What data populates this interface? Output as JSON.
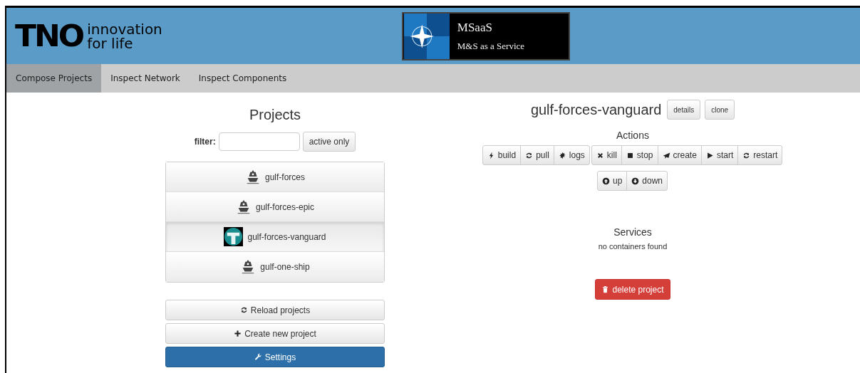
{
  "header": {
    "logo": {
      "mark": "TNO",
      "tagline_1": "innovation",
      "tagline_2": "for life"
    },
    "banner": {
      "title": "MSaaS",
      "subtitle": "M&S as a Service"
    }
  },
  "tabs": [
    {
      "label": "Compose Projects",
      "selected": true
    },
    {
      "label": "Inspect Network",
      "selected": false
    },
    {
      "label": "Inspect Components",
      "selected": false
    }
  ],
  "projects": {
    "title": "Projects",
    "filter_label": "filter:",
    "active_only": "active only",
    "items": [
      {
        "name": "gulf-forces",
        "kind": "ship",
        "selected": false
      },
      {
        "name": "gulf-forces-epic",
        "kind": "ship",
        "selected": false
      },
      {
        "name": "gulf-forces-vanguard",
        "kind": "emblem",
        "selected": true
      },
      {
        "name": "gulf-one-ship",
        "kind": "ship",
        "selected": false
      }
    ],
    "buttons": [
      {
        "label": "Reload projects",
        "kind": "reload"
      },
      {
        "label": "Create new project",
        "kind": "plus"
      },
      {
        "label": "Settings",
        "kind": "wrench"
      }
    ]
  },
  "detail": {
    "title": "gulf-forces-vanguard",
    "buttons": [
      "details",
      "clone"
    ],
    "actions_title": "Actions",
    "action_groups": [
      [
        {
          "label": "build",
          "kind": "bolt"
        },
        {
          "label": "pull",
          "kind": "reload"
        },
        {
          "label": "logs",
          "kind": "burst"
        }
      ],
      [
        {
          "label": "kill",
          "kind": "cross"
        },
        {
          "label": "stop",
          "kind": "square"
        },
        {
          "label": "create",
          "kind": "send"
        },
        {
          "label": "start",
          "kind": "play"
        },
        {
          "label": "restart",
          "kind": "reload"
        }
      ],
      [
        {
          "label": "up",
          "kind": "up"
        },
        {
          "label": "down",
          "kind": "down"
        }
      ]
    ],
    "services_title": "Services",
    "services_empty": "no containers found",
    "delete": "delete project"
  }
}
